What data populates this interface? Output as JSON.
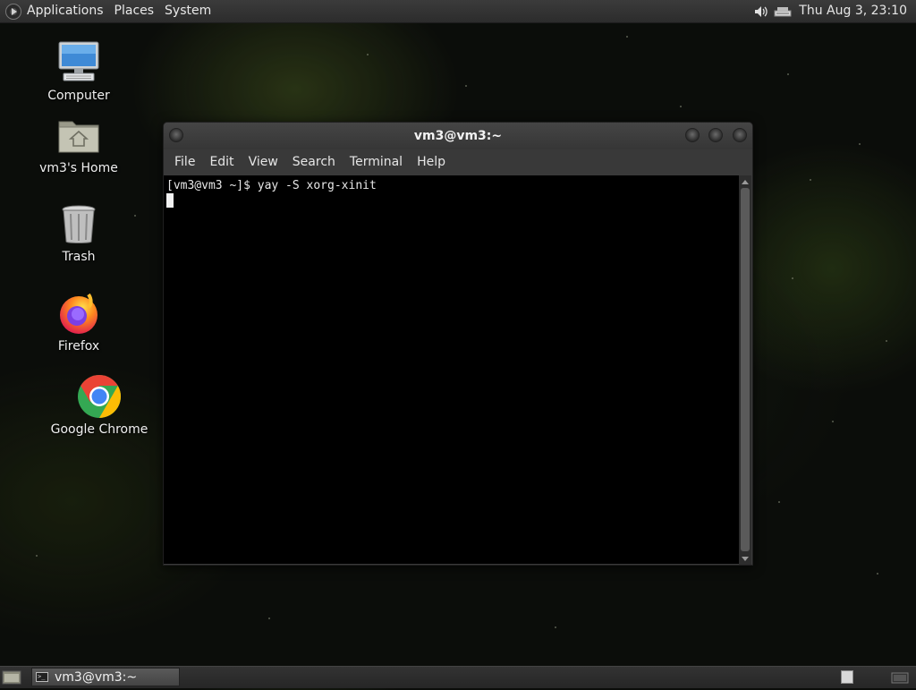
{
  "top_panel": {
    "menus": [
      "Applications",
      "Places",
      "System"
    ],
    "tray_icons": [
      "volume-icon",
      "network-icon"
    ],
    "clock": "Thu Aug  3, 23:10"
  },
  "desktop_icons": [
    {
      "label": "Computer",
      "icon": "computer-icon"
    },
    {
      "label": "vm3's Home",
      "icon": "home-folder-icon"
    },
    {
      "label": "Trash",
      "icon": "trash-icon"
    },
    {
      "label": "Firefox",
      "icon": "firefox-icon"
    },
    {
      "label": "Google Chrome",
      "icon": "chrome-icon"
    }
  ],
  "terminal": {
    "title": "vm3@vm3:~",
    "menu": [
      "File",
      "Edit",
      "View",
      "Search",
      "Terminal",
      "Help"
    ],
    "prompt_line": "[vm3@vm3 ~]$ yay -S xorg-xinit"
  },
  "taskbar": {
    "tasks": [
      {
        "label": "vm3@vm3:~",
        "icon": "terminal-icon"
      }
    ]
  }
}
